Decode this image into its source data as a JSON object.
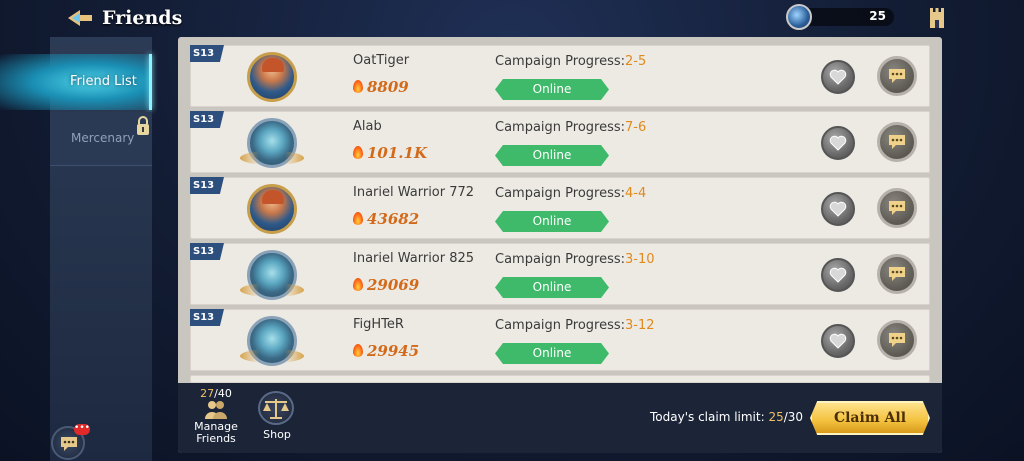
{
  "header": {
    "title": "Friends",
    "currency_amount": "25"
  },
  "sidebar": {
    "tabs": [
      {
        "label": "Friend List",
        "active": true
      },
      {
        "label": "Mercenary",
        "locked": true
      }
    ]
  },
  "friends": [
    {
      "season": "S13",
      "name": "OatTiger",
      "power": "8809",
      "campaign_label": "Campaign Progress:",
      "campaign": "2-5",
      "status": "Online",
      "avatar": "hero"
    },
    {
      "season": "S13",
      "name": "Alab",
      "power": "101.1K",
      "campaign_label": "Campaign Progress:",
      "campaign": "7-6",
      "status": "Online",
      "avatar": "emblem"
    },
    {
      "season": "S13",
      "name": "Inariel Warrior 772",
      "power": "43682",
      "campaign_label": "Campaign Progress:",
      "campaign": "4-4",
      "status": "Online",
      "avatar": "hero"
    },
    {
      "season": "S13",
      "name": "Inariel Warrior 825",
      "power": "29069",
      "campaign_label": "Campaign Progress:",
      "campaign": "3-10",
      "status": "Online",
      "avatar": "emblem"
    },
    {
      "season": "S13",
      "name": "FigHTeR",
      "power": "29945",
      "campaign_label": "Campaign Progress:",
      "campaign": "3-12",
      "status": "Online",
      "avatar": "emblem"
    }
  ],
  "bottom": {
    "friend_count": "27",
    "friend_max": "/40",
    "manage_label": "Manage Friends",
    "shop_label": "Shop",
    "claim_label": "Today's claim limit: ",
    "claim_current": "25",
    "claim_max": "/30",
    "claim_button": "Claim All"
  },
  "chat_badge": "•••",
  "colors": {
    "online": "#3eba6a",
    "accent_gold": "#f3c13e",
    "campaign_value": "#e08a1e",
    "power": "#d26a1a"
  }
}
